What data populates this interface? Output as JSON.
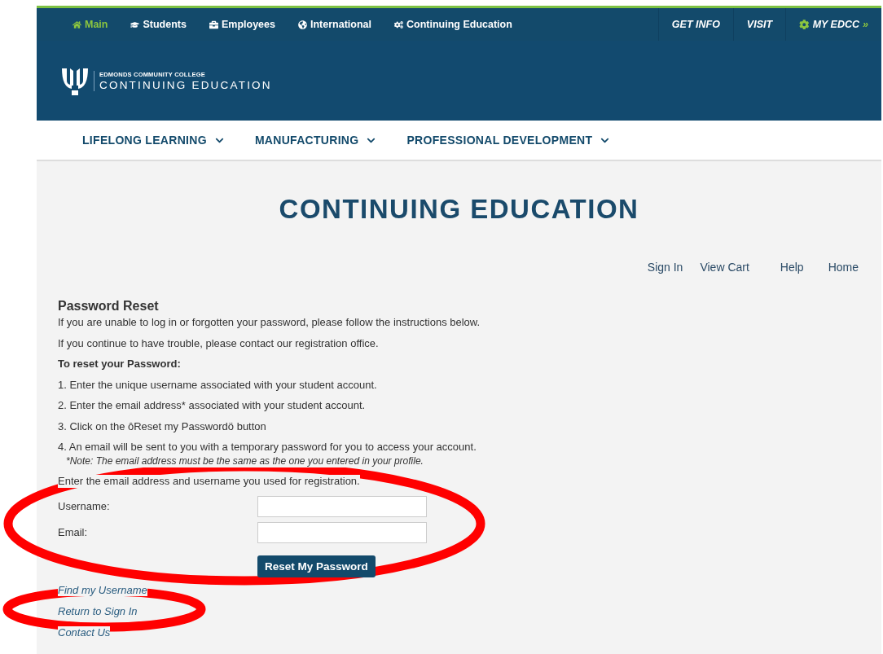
{
  "top_nav": {
    "links": [
      {
        "label": "Main",
        "selected": true
      },
      {
        "label": "Students",
        "selected": false
      },
      {
        "label": "Employees",
        "selected": false
      },
      {
        "label": "International",
        "selected": false
      },
      {
        "label": "Continuing Education",
        "selected": false
      }
    ],
    "right_links": [
      {
        "label": "GET INFO",
        "kind": "plain"
      },
      {
        "label": "VISIT",
        "kind": "plain"
      },
      {
        "label": "MY EDCC",
        "kind": "account",
        "suffix": "»"
      }
    ]
  },
  "logo": {
    "college": "EDMONDS COMMUNITY COLLEGE",
    "name": "CONTINUING EDUCATION"
  },
  "main_nav": [
    {
      "label": "LIFELONG LEARNING"
    },
    {
      "label": "MANUFACTURING"
    },
    {
      "label": "PROFESSIONAL DEVELOPMENT"
    }
  ],
  "page_title": "CONTINUING EDUCATION",
  "utility_links": [
    "Sign In",
    "View Cart",
    "Help",
    "Home"
  ],
  "reset": {
    "heading": "Password Reset",
    "paragraphs": [
      "If you are unable to log in or forgotten your password, please follow the instructions below.",
      "If you continue to have trouble, please contact our registration office."
    ],
    "steps_heading": "To reset your Password:",
    "steps": [
      "1. Enter the unique username associated with your student account.",
      "2. Enter the email address* associated with your student account.",
      "3. Click on the ôReset my Passwordö button",
      "4. An email will be sent to you with a temporary password for you to access your account."
    ],
    "note": "*Note: The email address must be the same as the one you entered in your profile.",
    "form_intro": "Enter the email address and username you used for registration.",
    "fields": [
      {
        "label": "Username:"
      },
      {
        "label": "Email:"
      }
    ],
    "button": "Reset My Password",
    "links": [
      "Find my Username",
      "Return to Sign In",
      "Contact Us"
    ]
  },
  "annotations": [
    {
      "kind": "ellipse"
    },
    {
      "kind": "ellipse"
    }
  ]
}
